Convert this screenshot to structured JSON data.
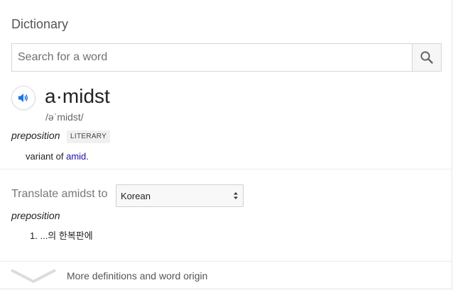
{
  "header": {
    "title": "Dictionary"
  },
  "search": {
    "placeholder": "Search for a word",
    "value": "",
    "button_icon": "search-icon"
  },
  "entry": {
    "speaker_icon": "speaker-icon",
    "word": "a·midst",
    "phonetic": "/əˈmidst/",
    "part_of_speech": "preposition",
    "register_tag": "LITERARY",
    "definition_prefix": "variant of ",
    "definition_link": "amid",
    "definition_suffix": "."
  },
  "translate": {
    "label": "Translate amidst to",
    "language": "Korean",
    "part_of_speech": "preposition",
    "items": [
      {
        "number": "1.",
        "text": "...의 한복판에"
      }
    ]
  },
  "footer": {
    "more_label": "More definitions and word origin",
    "chevron_icon": "chevron-down-icon"
  },
  "colors": {
    "link": "#1a0dab",
    "speaker_accent": "#1a73e8",
    "muted": "#777777"
  }
}
